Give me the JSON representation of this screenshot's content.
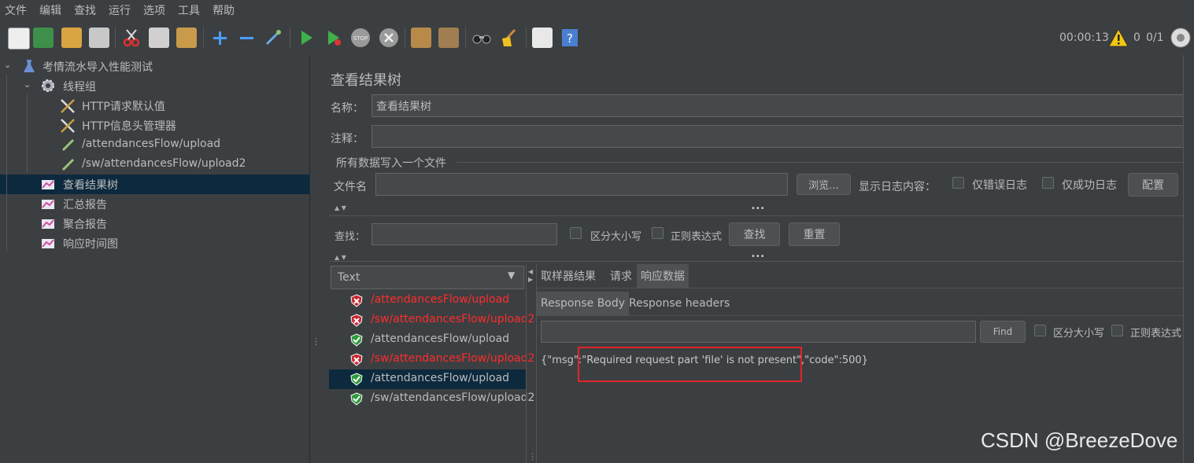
{
  "menu": [
    "文件",
    "编辑",
    "查找",
    "运行",
    "选项",
    "工具",
    "帮助"
  ],
  "toolbar_status": {
    "timer": "00:00:13",
    "warnings": "0",
    "threads": "0/1"
  },
  "tree": [
    {
      "label": "考情流水导入性能测试",
      "icon": "test-plan-icon"
    },
    {
      "label": "线程组",
      "icon": "thread-group-gear-icon"
    },
    {
      "label": "HTTP请求默认值",
      "icon": "config-tools-icon"
    },
    {
      "label": "HTTP信息头管理器",
      "icon": "config-tools-icon"
    },
    {
      "label": "/attendancesFlow/upload",
      "icon": "sampler-pipette-icon"
    },
    {
      "label": "/sw/attendancesFlow/upload2",
      "icon": "sampler-pipette-icon"
    },
    {
      "label": "查看结果树",
      "icon": "listener-chart-icon"
    },
    {
      "label": "汇总报告",
      "icon": "listener-chart-icon"
    },
    {
      "label": "聚合报告",
      "icon": "listener-chart-icon"
    },
    {
      "label": "响应时间图",
      "icon": "listener-chart-icon"
    }
  ],
  "panel": {
    "title": "查看结果树",
    "name_label": "名称：",
    "name_value": "查看结果树",
    "comment_label": "注释：",
    "comment_value": "",
    "file_section": "所有数据写入一个文件",
    "filename_label": "文件名",
    "browse": "浏览...",
    "log_label": "显示日志内容：",
    "errors_only": "仅错误日志",
    "success_only": "仅成功日志",
    "configure": "配置",
    "search_label": "查找：",
    "case_sensitive": "区分大小写",
    "regex": "正则表达式",
    "search_btn": "查找",
    "reset_btn": "重置"
  },
  "renderer": "Text",
  "results": [
    {
      "label": "/attendancesFlow/upload",
      "status": "error"
    },
    {
      "label": "/sw/attendancesFlow/upload2",
      "status": "error"
    },
    {
      "label": "/attendancesFlow/upload",
      "status": "success"
    },
    {
      "label": "/sw/attendancesFlow/upload2",
      "status": "error"
    },
    {
      "label": "/attendancesFlow/upload",
      "status": "success"
    },
    {
      "label": "/sw/attendancesFlow/upload2",
      "status": "success"
    }
  ],
  "detail_tabs": [
    "取样器结果",
    "请求",
    "响应数据"
  ],
  "body_tabs": [
    "Response Body",
    "Response headers"
  ],
  "find_btn": "Find",
  "find_case": "区分大小写",
  "find_regex": "正则表达式",
  "response_body": "{\"msg\":\"Required request part 'file' is not present\",\"code\":500}",
  "watermark": "CSDN @BreezeDove",
  "colors": {
    "error": "#ff2b2b",
    "success": "#bbbbbb",
    "highlight_box": "#e0242a",
    "selection": "#0d293e"
  }
}
